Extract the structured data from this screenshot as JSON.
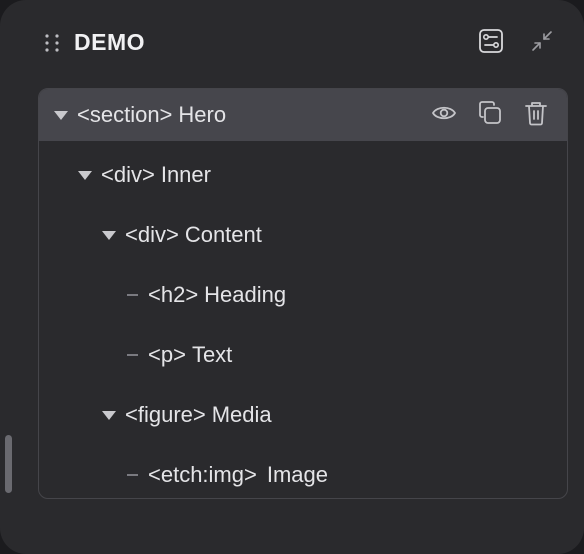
{
  "header": {
    "title": "DEMO",
    "drag_icon": "drag-handle-icon",
    "settings_icon": "settings-sliders-icon",
    "collapse_icon": "collapse-arrows-icon"
  },
  "tree": {
    "rows": [
      {
        "tag": "<section>",
        "label": "Hero",
        "expanded": true,
        "selected": true
      },
      {
        "tag": "<div>",
        "label": "Inner",
        "expanded": true
      },
      {
        "tag": "<div>",
        "label": "Content",
        "expanded": true
      },
      {
        "tag": "<h2>",
        "label": "Heading",
        "leaf": true
      },
      {
        "tag": "<p>",
        "label": "Text",
        "leaf": true
      },
      {
        "tag": "<figure>",
        "label": "Media",
        "expanded": true
      },
      {
        "tag": "<etch:img>",
        "label": "Image",
        "leaf": true
      }
    ],
    "row_actions": [
      "eye-icon",
      "duplicate-icon",
      "trash-icon"
    ]
  },
  "colors": {
    "panel_bg": "#2a2a2d",
    "page_bg": "#1b1b1e",
    "selected_row_bg": "#46464c",
    "border": "#45454a",
    "text": "#e4e4e7"
  }
}
